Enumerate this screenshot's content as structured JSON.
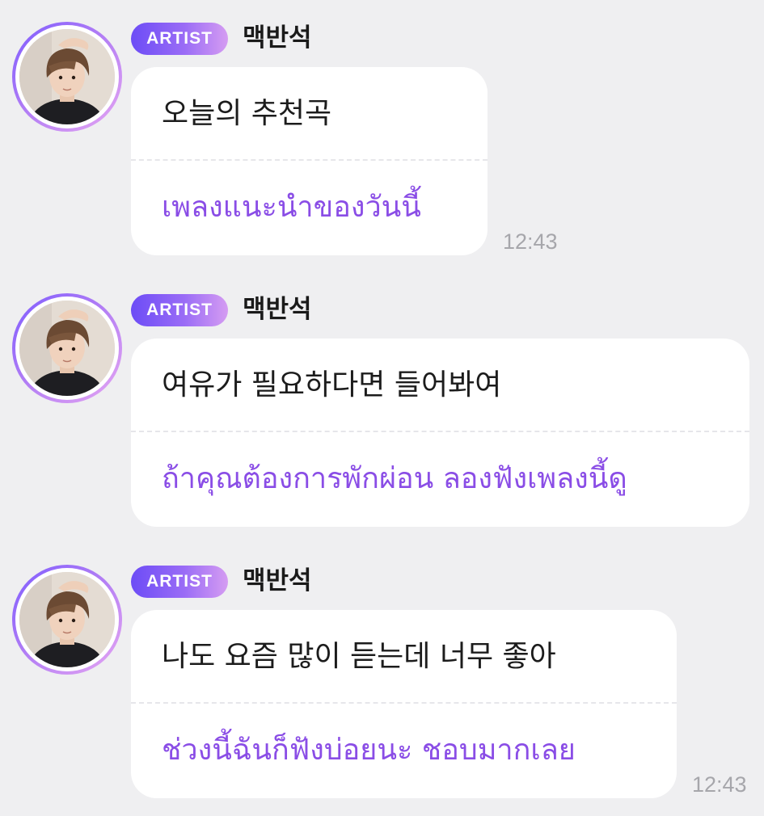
{
  "messages": [
    {
      "badge": "ARTIST",
      "sender": "맥반석",
      "text": "오늘의 추천곡",
      "translation": "เพลงแนะนำของวันนี้",
      "time": "12:43"
    },
    {
      "badge": "ARTIST",
      "sender": "맥반석",
      "text": "여유가 필요하다면 들어봐여",
      "translation": "ถ้าคุณต้องการพักผ่อน ลองฟังเพลงนี้ดู",
      "time": ""
    },
    {
      "badge": "ARTIST",
      "sender": "맥반석",
      "text": "나도 요즘 많이 듣는데 너무 좋아",
      "translation": "ช่วงนี้ฉันก็ฟังบ่อยนะ ชอบมากเลย",
      "time": "12:43"
    }
  ],
  "colors": {
    "background": "#efeff1",
    "bubble": "#ffffff",
    "translation_text": "#8a4de6",
    "badge_start": "#6c4cf6",
    "badge_end": "#d59cf2",
    "timestamp": "#a6a6ab"
  }
}
